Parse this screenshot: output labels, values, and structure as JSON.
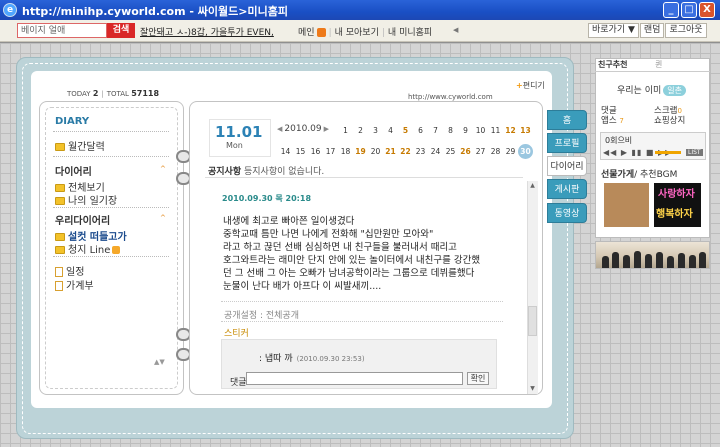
{
  "window": {
    "title": "http://minihp.cyworld.com - 싸이월드>미니홈피",
    "btn_min": "_",
    "btn_max": "□",
    "btn_close": "X",
    "ie_icon": "e"
  },
  "toolbar": {
    "search_value": "베이지 얼애",
    "search_button": "검색",
    "ticker_text": "잘안돼고 ㅅ-)8갑, 가을투가 EVEN,",
    "nav": [
      "메인",
      "내 모아보기",
      "내 미니홈피"
    ],
    "scroll_left": "◀",
    "buttons": [
      "바로가기 ▼",
      "랜덤",
      "로그아웃"
    ]
  },
  "header": {
    "today_label": "TODAY",
    "today_value": "2",
    "total_label": "TOTAL",
    "total_value": "57118",
    "url": "http://www.cyworld.com",
    "edit_link": "편디기",
    "edit_plus": "+"
  },
  "left": {
    "title": "DIARY",
    "items_top": [
      "월간달력"
    ],
    "group1_title": "다이어리",
    "group1_items": [
      "전체보기",
      "나의 일기장"
    ],
    "group2_title": "우리다이어리",
    "group2_items": [
      "설컷 떠들고가",
      "청지 Line"
    ],
    "other_items": [
      "일정",
      "가계부"
    ],
    "caret": "^",
    "bottom_arrows": "▲▼"
  },
  "calendar": {
    "date": "11.01",
    "day": "Mon",
    "month": "2010.09",
    "prev": "◀",
    "next": "▶",
    "row1": [
      "1",
      "2",
      "3",
      "4",
      "5",
      "6",
      "7",
      "8",
      "9",
      "10",
      "11",
      "12",
      "13"
    ],
    "row2": [
      "14",
      "15",
      "16",
      "17",
      "18",
      "19",
      "20",
      "21",
      "22",
      "23",
      "24",
      "25",
      "26",
      "27",
      "28",
      "29",
      "30"
    ]
  },
  "notice": {
    "label": "공지사항",
    "text": "등지사항이 없습니다."
  },
  "post": {
    "date": "2010.09.30 목 20:18",
    "lines": [
      "내생에 최고로 빠아쯘 일이생겼다",
      "중학교때 틈만 나면 나에게 전화해 \"십만원만 모아와\"",
      "라고 하고 끊던 선배 심심하면 내 친구들을 불러내서 때리고",
      "호그와트라는 래미안 단지 안에 있는 놀이터에서 내친구를 강간했",
      "던 그 선배 그 아는 오빠가 남녀공학이라는 그룹으로 데뷔를했다",
      "눈물이 난다 배가 아프다 이 씨발새끼...."
    ],
    "privacy": "공개설정 : 전체공개",
    "sticker": "스티커",
    "comment_text": ": 냅따 까",
    "comment_date": "(2010.09.30 23:53)",
    "reply_label": "댓글",
    "reply_button": "확인",
    "scroll_up": "▲",
    "scroll_down": "▼"
  },
  "tabs": [
    "홈",
    "프로필",
    "다이어리",
    "게시판",
    "동영상"
  ],
  "right_panel": {
    "tab1": "친구추천",
    "tab2": "퀸",
    "friend_text": "우리는 이미",
    "friend_badge": "일촌",
    "grid": [
      [
        "댓글",
        "스크랩"
      ],
      [
        "앱스",
        "쇼핑상지"
      ]
    ],
    "grid_nums": [
      "7",
      "0"
    ],
    "bgm_title": "0회으비",
    "bgm_ctrls": "◀◀ ▶ ▮▮ ■ ▶▶",
    "bgm_list": "LIST",
    "gift_title": "선물가게",
    "gift_sub": "/ 추천BGM",
    "gift_img_line1": "사랑하자",
    "gift_img_line2": "행복하자"
  }
}
